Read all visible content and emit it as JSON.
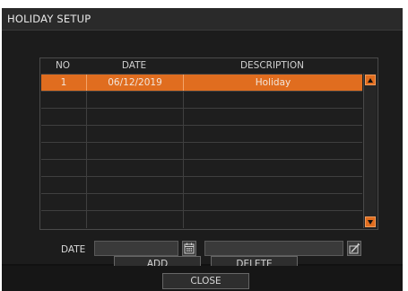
{
  "window": {
    "title": "HOLIDAY SETUP"
  },
  "table": {
    "columns": [
      "NO",
      "DATE",
      "DESCRIPTION"
    ],
    "rows": [
      {
        "no": "1",
        "date": "06/12/2019",
        "description": "Holiday",
        "selected": true
      }
    ]
  },
  "form": {
    "date_label": "DATE",
    "date_value": "",
    "description_value": ""
  },
  "buttons": {
    "add": "ADD",
    "delete": "DELETE",
    "close": "CLOSE"
  },
  "icons": {
    "calendar": "calendar-icon",
    "edit": "edit-icon",
    "scroll_up": "up-arrow-icon",
    "scroll_down": "down-arrow-icon"
  },
  "colors": {
    "accent": "#e06d1f",
    "background": "#1c1c1c",
    "text": "#d8d8d8"
  }
}
